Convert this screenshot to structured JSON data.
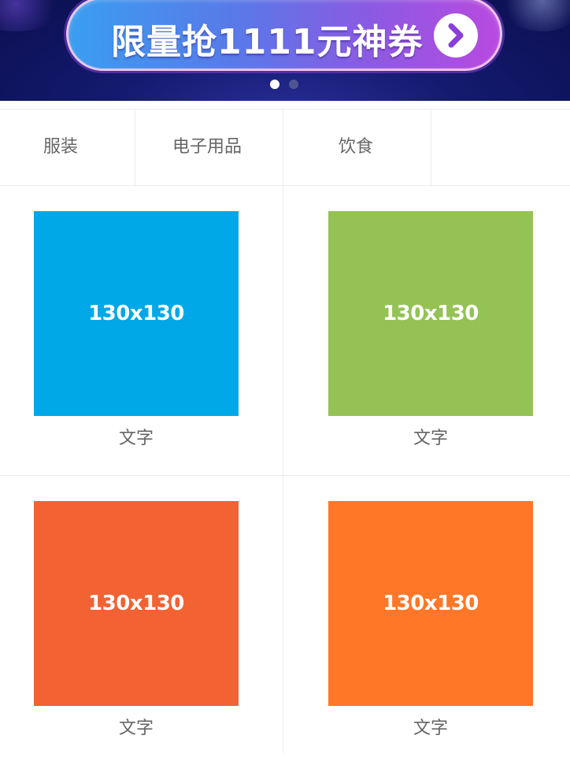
{
  "banner": {
    "promo_text": "限量抢1111元神券",
    "arrow_icon": "chevron-right-icon",
    "slides": [
      {
        "active": true
      },
      {
        "active": false
      }
    ],
    "colors": {
      "background": "#141a6e",
      "pill_start": "#3a9ef0",
      "pill_end": "#b84ae0"
    }
  },
  "tabs": [
    {
      "label": "服装"
    },
    {
      "label": "电子用品"
    },
    {
      "label": "饮食"
    }
  ],
  "grid": {
    "items": [
      {
        "placeholder": "130x130",
        "caption": "文字",
        "color": "#00a8e8"
      },
      {
        "placeholder": "130x130",
        "caption": "文字",
        "color": "#94c255"
      },
      {
        "placeholder": "130x130",
        "caption": "文字",
        "color": "#f26232"
      },
      {
        "placeholder": "130x130",
        "caption": "文字",
        "color": "#ff7727"
      }
    ]
  }
}
